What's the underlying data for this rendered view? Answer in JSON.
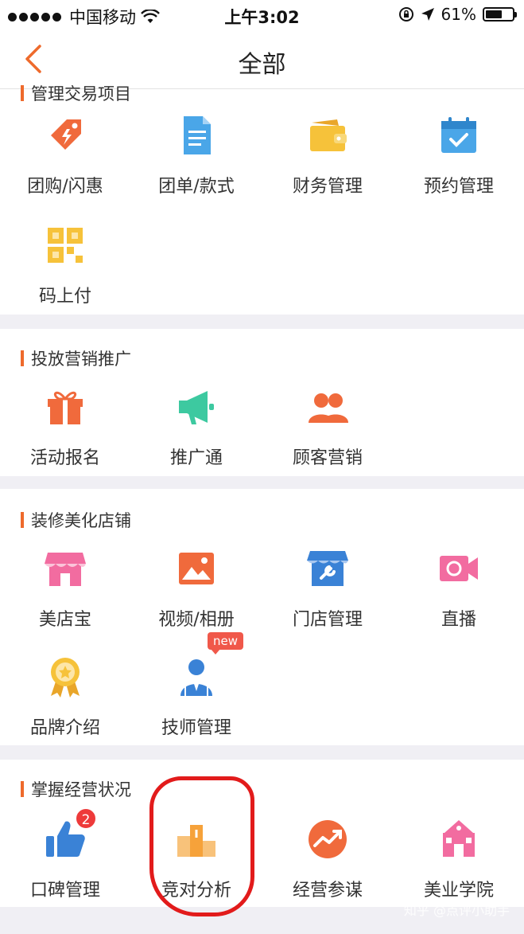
{
  "status_bar": {
    "carrier": "中国移动",
    "time": "上午3:02",
    "battery": "61%",
    "battery_level": 0.61
  },
  "nav": {
    "title": "全部"
  },
  "sections": [
    {
      "title": "管理交易项目",
      "items": [
        {
          "label": "团购/闪惠",
          "icon": "tag-icon",
          "color": "#f06a3c"
        },
        {
          "label": "团单/款式",
          "icon": "document-icon",
          "color": "#4aa6e8"
        },
        {
          "label": "财务管理",
          "icon": "wallet-icon",
          "color": "#f6c23a"
        },
        {
          "label": "预约管理",
          "icon": "calendar-icon",
          "color": "#4aa6e8"
        },
        {
          "label": "码上付",
          "icon": "qrcode-icon",
          "color": "#f6c23a"
        }
      ]
    },
    {
      "title": "投放营销推广",
      "items": [
        {
          "label": "活动报名",
          "icon": "gift-icon",
          "color": "#f06a3c"
        },
        {
          "label": "推广通",
          "icon": "megaphone-icon",
          "color": "#3dc9a0"
        },
        {
          "label": "顾客营销",
          "icon": "users-icon",
          "color": "#f06a3c"
        }
      ]
    },
    {
      "title": "装修美化店铺",
      "items": [
        {
          "label": "美店宝",
          "icon": "shop-icon",
          "color": "#f26ca0"
        },
        {
          "label": "视频/相册",
          "icon": "image-icon",
          "color": "#f06a3c"
        },
        {
          "label": "门店管理",
          "icon": "store-tools-icon",
          "color": "#3a82d6"
        },
        {
          "label": "直播",
          "icon": "video-camera-icon",
          "color": "#f26ca0"
        },
        {
          "label": "品牌介绍",
          "icon": "award-medal-icon",
          "color": "#f6c23a"
        },
        {
          "label": "技师管理",
          "icon": "technician-icon",
          "color": "#3a82d6",
          "tag": "new"
        }
      ]
    },
    {
      "title": "掌握经营状况",
      "items": [
        {
          "label": "口碑管理",
          "icon": "thumbs-up-icon",
          "color": "#3a82d6",
          "badge": "2"
        },
        {
          "label": "竞对分析",
          "icon": "podium-icon",
          "color": "#f6a23a"
        },
        {
          "label": "经营参谋",
          "icon": "trend-icon",
          "color": "#f06a3c"
        },
        {
          "label": "美业学院",
          "icon": "academy-icon",
          "color": "#f26ca0"
        }
      ]
    }
  ],
  "watermark": "知乎 @点评小助手"
}
